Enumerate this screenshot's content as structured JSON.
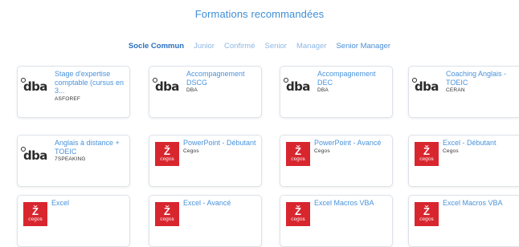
{
  "section": {
    "title": "Formations recommandées"
  },
  "tabs": [
    {
      "label": "Socle Commun"
    },
    {
      "label": "Junior"
    },
    {
      "label": "Confirmé"
    },
    {
      "label": "Senior"
    },
    {
      "label": "Manager"
    },
    {
      "label": "Senior Manager"
    }
  ],
  "cards": [
    {
      "title": "Stage d'expertise comptable (cursus en 3...",
      "org": "ASFOREF",
      "logo": "dba"
    },
    {
      "title": "Accompagnement DSCG",
      "org": "DBA",
      "logo": "dba"
    },
    {
      "title": "Accompagnement DEC",
      "org": "DBA",
      "logo": "dba"
    },
    {
      "title": "Coaching Anglais - TOEIC",
      "org": "CERAN",
      "logo": "dba"
    },
    {
      "title": "Anglais à distance + TOEIC",
      "org": "7SPEAKING",
      "logo": "dba"
    },
    {
      "title": "PowerPoint - Débutant",
      "org": "Cegos",
      "logo": "cegos"
    },
    {
      "title": "PowerPoint - Avancé",
      "org": "Cegos",
      "logo": "cegos"
    },
    {
      "title": "Excel - Débutant",
      "org": "Cegos",
      "logo": "cegos"
    },
    {
      "title": "Excel",
      "org": "",
      "logo": "cegos"
    },
    {
      "title": "Excel - Avancé",
      "org": "",
      "logo": "cegos"
    },
    {
      "title": "Excel Macros VBA",
      "org": "",
      "logo": "cegos"
    },
    {
      "title": "Excel Macros VBA",
      "org": "",
      "logo": "cegos"
    }
  ],
  "logos": {
    "dba": "dba",
    "cegos_mark": "Ž",
    "cegos_word": "cegos"
  },
  "colors": {
    "accent": "#3f8fd6",
    "cegos_red": "#d8262f"
  }
}
